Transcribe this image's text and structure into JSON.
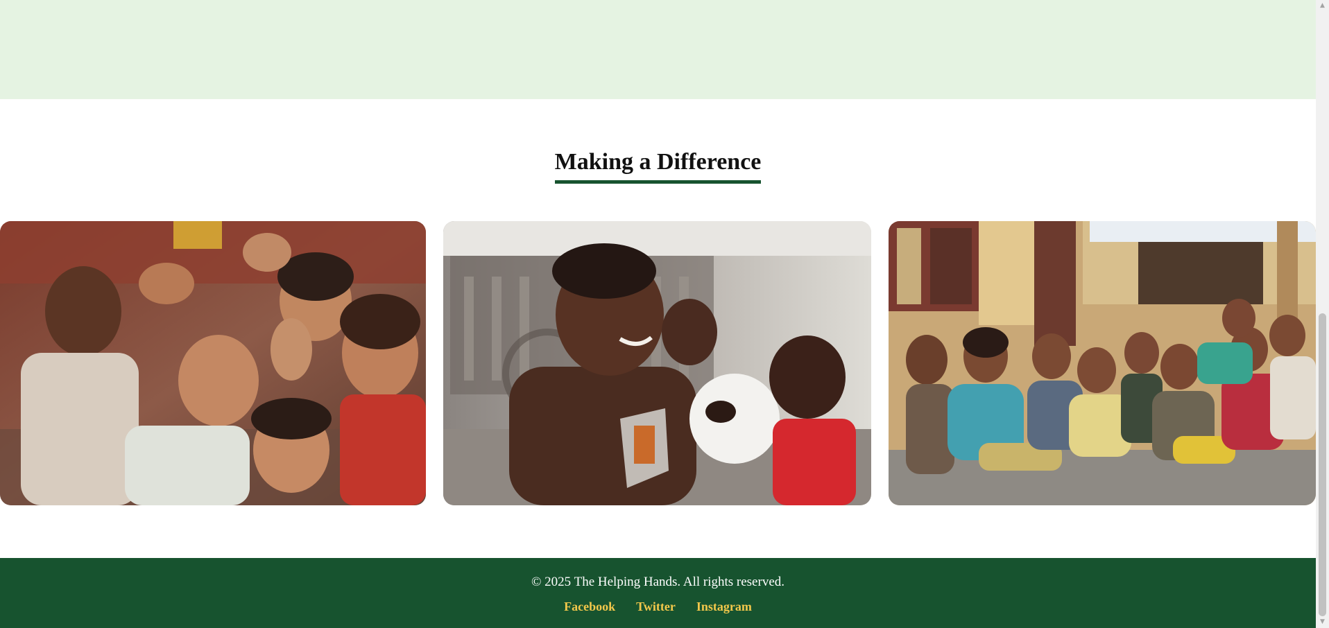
{
  "section": {
    "title": "Making a Difference"
  },
  "gallery": {
    "images": [
      {
        "name": "children-peace-signs-photo"
      },
      {
        "name": "boy-holding-snack-photo"
      },
      {
        "name": "children-seated-group-photo"
      }
    ]
  },
  "footer": {
    "copyright": "© 2025 The Helping Hands. All rights reserved.",
    "links": [
      "Facebook",
      "Twitter",
      "Instagram"
    ]
  },
  "colors": {
    "top_band": "#e5f3e2",
    "accent_green": "#17532f",
    "link_gold": "#f3c84b"
  },
  "icons": {
    "scroll_up": "scroll-up-icon",
    "scroll_down": "scroll-down-icon"
  }
}
